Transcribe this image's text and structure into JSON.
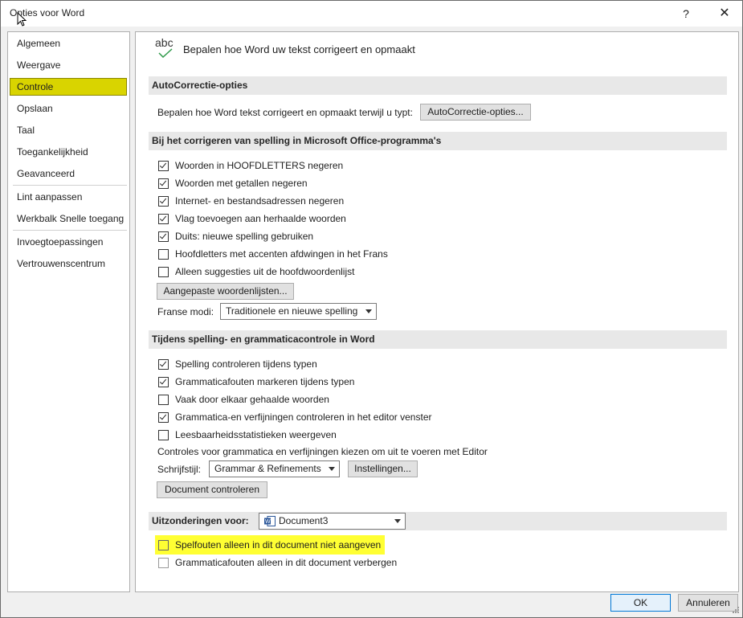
{
  "window": {
    "title": "Opties voor Word",
    "help": "?",
    "close": "✕"
  },
  "nav": {
    "items": [
      {
        "label": "Algemeen"
      },
      {
        "label": "Weergave"
      },
      {
        "label": "Controle"
      },
      {
        "label": "Opslaan"
      },
      {
        "label": "Taal"
      },
      {
        "label": "Toegankelijkheid"
      },
      {
        "label": "Geavanceerd"
      },
      {
        "label": "Lint aanpassen"
      },
      {
        "label": "Werkbalk Snelle toegang"
      },
      {
        "label": "Invoegtoepassingen"
      },
      {
        "label": "Vertrouwenscentrum"
      }
    ],
    "selected": "Controle"
  },
  "header": {
    "icon_text": "abc",
    "title": "Bepalen hoe Word uw tekst corrigeert en opmaakt"
  },
  "autocorrect": {
    "section": "AutoCorrectie-opties",
    "description": "Bepalen hoe Word tekst corrigeert en opmaakt terwijl u typt:",
    "button": "AutoCorrectie-opties..."
  },
  "office_spelling": {
    "section": "Bij het corrigeren van spelling in Microsoft Office-programma's",
    "options": [
      {
        "label": "Woorden in HOOFDLETTERS negeren",
        "checked": true
      },
      {
        "label": "Woorden met getallen negeren",
        "checked": true
      },
      {
        "label": "Internet- en bestandsadressen negeren",
        "checked": true
      },
      {
        "label": "Vlag toevoegen aan herhaalde woorden",
        "checked": true
      },
      {
        "label": "Duits: nieuwe spelling gebruiken",
        "checked": true
      },
      {
        "label": "Hoofdletters met accenten afdwingen in het Frans",
        "checked": false
      },
      {
        "label": "Alleen suggesties uit de hoofdwoordenlijst",
        "checked": false
      }
    ],
    "custom_dict_button": "Aangepaste woordenlijsten...",
    "french_modes_label": "Franse modi:",
    "french_modes_value": "Traditionele en nieuwe spelling"
  },
  "word_spelling": {
    "section": "Tijdens spelling- en grammaticacontrole in Word",
    "options": [
      {
        "label": "Spelling controleren tijdens typen",
        "checked": true
      },
      {
        "label": "Grammaticafouten markeren tijdens typen",
        "checked": true
      },
      {
        "label": "Vaak door elkaar gehaalde woorden",
        "checked": false
      },
      {
        "label": "Grammatica-en verfijningen controleren in het editor venster",
        "checked": true
      },
      {
        "label": "Leesbaarheidsstatistieken weergeven",
        "checked": false
      }
    ],
    "editor_note": "Controles voor grammatica en verfijningen kiezen om uit te voeren met Editor",
    "style_label": "Schrijfstijl:",
    "style_value": "Grammar & Refinements",
    "settings_button": "Instellingen...",
    "check_document_button": "Document controleren"
  },
  "exceptions": {
    "label": "Uitzonderingen voor:",
    "document": "Document3",
    "options": [
      {
        "label": "Spelfouten alleen in dit document niet aangeven",
        "checked": false
      },
      {
        "label": "Grammaticafouten alleen in dit document verbergen",
        "checked": false
      }
    ]
  },
  "footer": {
    "ok": "OK",
    "cancel": "Annuleren"
  },
  "colors": {
    "selection": "#d9d400",
    "highlight": "#ffff33",
    "primary_border": "#0078d7"
  }
}
